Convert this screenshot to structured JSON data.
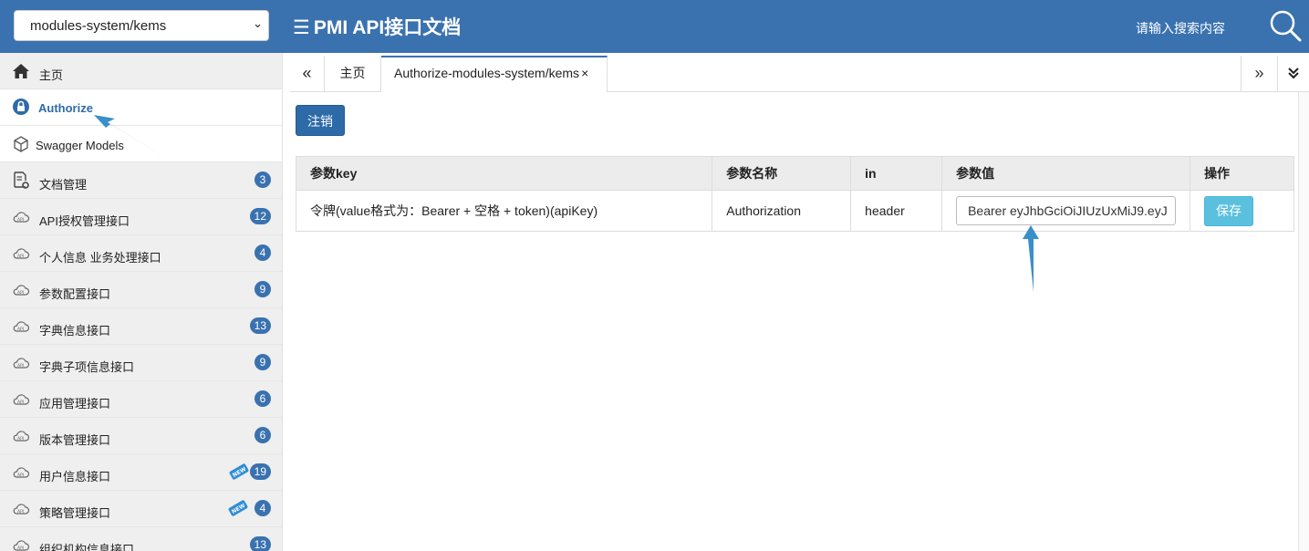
{
  "header": {
    "module_select": "modules-system/kems",
    "title": "PMI API接口文档",
    "search_placeholder": "请输入搜索内容"
  },
  "sidebar": {
    "items": [
      {
        "label": "主页",
        "icon": "home-icon"
      },
      {
        "label": "Authorize",
        "icon": "lock-icon"
      },
      {
        "label": "Swagger Models",
        "icon": "cube-icon"
      },
      {
        "label": "文档管理",
        "icon": "document-gear-icon",
        "badge": "3"
      },
      {
        "label": "API授权管理接口",
        "icon": "api-cloud-icon",
        "badge": "12"
      },
      {
        "label": "个人信息 业务处理接口",
        "icon": "api-cloud-icon",
        "badge": "4"
      },
      {
        "label": "参数配置接口",
        "icon": "api-cloud-icon",
        "badge": "9"
      },
      {
        "label": "字典信息接口",
        "icon": "api-cloud-icon",
        "badge": "13"
      },
      {
        "label": "字典子项信息接口",
        "icon": "api-cloud-icon",
        "badge": "9"
      },
      {
        "label": "应用管理接口",
        "icon": "api-cloud-icon",
        "badge": "6"
      },
      {
        "label": "版本管理接口",
        "icon": "api-cloud-icon",
        "badge": "6"
      },
      {
        "label": "用户信息接口",
        "icon": "api-cloud-icon",
        "badge": "19",
        "new": "NEW"
      },
      {
        "label": "策略管理接口",
        "icon": "api-cloud-icon",
        "badge": "4",
        "new": "NEW"
      },
      {
        "label": "组织机构信息接口",
        "icon": "api-cloud-icon",
        "badge": "13"
      }
    ]
  },
  "tabs": {
    "prev": "«",
    "home": "主页",
    "active": "Authorize-modules-system/kems",
    "close": "×",
    "next": "»",
    "menu": "⌄"
  },
  "main": {
    "logout_label": "注销",
    "columns": [
      "参数key",
      "参数名称",
      "in",
      "参数值",
      "操作"
    ],
    "rows": [
      {
        "key": "令牌(value格式为：Bearer + 空格 + token)(apiKey)",
        "name": "Authorization",
        "in": "header",
        "value": "Bearer eyJhbGciOiJIUzUxMiJ9.eyJ",
        "action": "保存"
      }
    ]
  },
  "colors": {
    "header_bg": "#3a72b0",
    "accent": "#2f6ba8",
    "save_button": "#5bc0de",
    "annotation_arrow": "#3a8fc9"
  }
}
